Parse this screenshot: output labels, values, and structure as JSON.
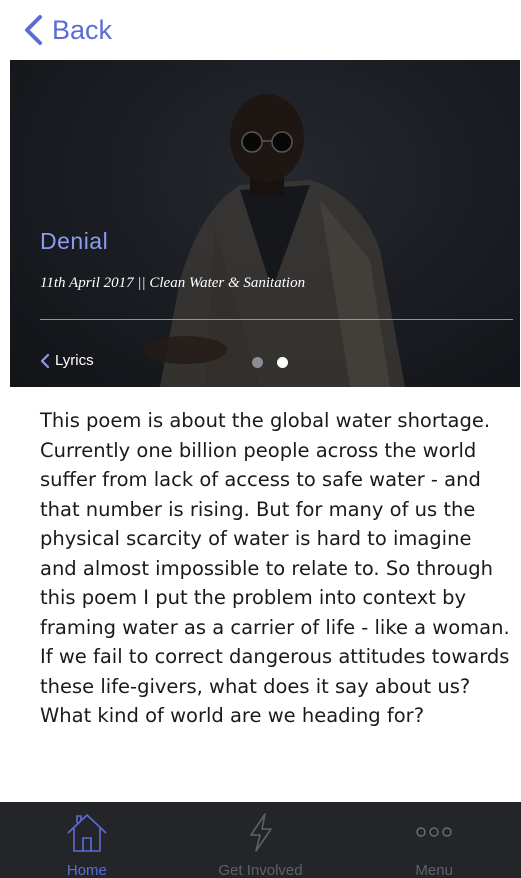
{
  "nav": {
    "back_label": "Back"
  },
  "hero": {
    "title": "Denial",
    "subtitle": "11th April 2017 || Clean Water & Sanitation",
    "lyrics_label": "Lyrics",
    "pages": 2,
    "active_page": 2
  },
  "description": "This poem is about the global water shortage. Currently one billion people across the world suffer from lack of access to safe water - and that number is rising. But for many of us the physical scarcity of water is hard to imagine and almost impossible to relate to. So through this poem I put the problem into context by framing water as a carrier of life - like a woman. If we fail to correct dangerous attitudes towards these life-givers, what does it say about us? What kind of world are we heading for?",
  "tabs": [
    {
      "label": "Home",
      "icon": "home-icon",
      "active": true
    },
    {
      "label": "Get Involved",
      "icon": "lightning-icon",
      "active": false
    },
    {
      "label": "Menu",
      "icon": "more-icon",
      "active": false
    }
  ],
  "colors": {
    "accent": "#5b6cd6",
    "hero_title": "#8d9af2",
    "tab_bar": "#232528",
    "tab_inactive": "#5e6166"
  }
}
